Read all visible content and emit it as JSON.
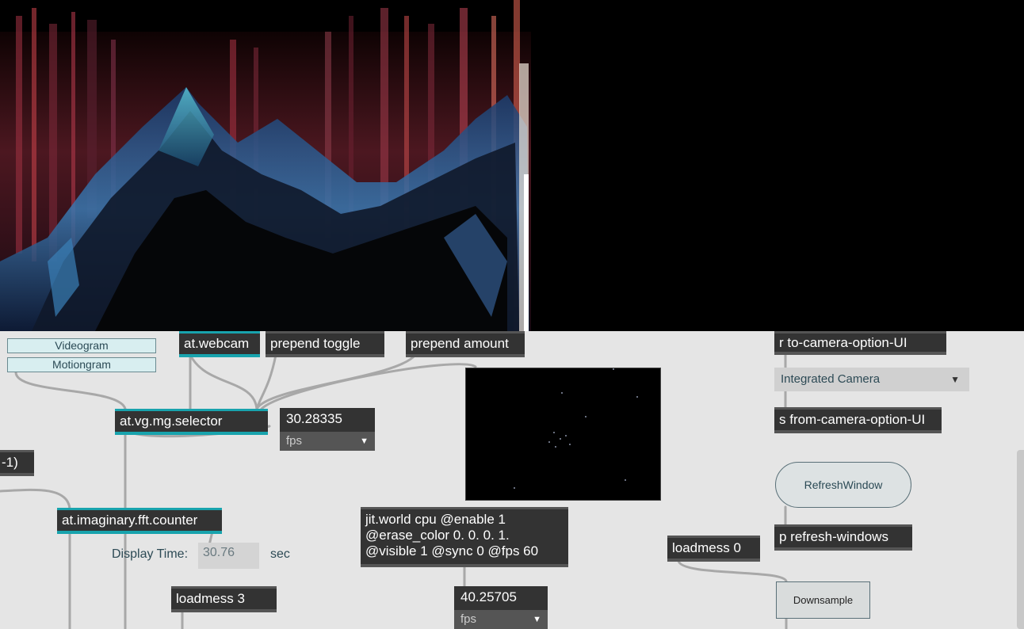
{
  "objects": {
    "at_webcam": "at.webcam",
    "prepend_toggle": "prepend toggle",
    "prepend_amount": "prepend amount",
    "selector": "at.vg.mg.selector",
    "fft_counter": "at.imaginary.fft.counter",
    "loadmess_3": "loadmess 3",
    "loadmess_0": "loadmess 0",
    "r_camera": "r to-camera-option-UI",
    "s_camera": "s from-camera-option-UI",
    "p_refresh": "p refresh-windows",
    "partial": "-1)",
    "jit_world": "jit.world cpu @enable 1\n@erase_color 0. 0. 0. 1.\n@visible 1 @sync 0 @fps 60"
  },
  "buttons": {
    "videogram": "Videogram",
    "motiongram": "Motiongram",
    "refresh_window": "RefreshWindow",
    "downsample": "Downsample"
  },
  "fps1": {
    "value": "30.28335",
    "unit": "fps"
  },
  "fps2": {
    "value": "40.25705",
    "unit": "fps"
  },
  "display_time": {
    "label": "Display Time:",
    "value": "30.76",
    "unit": "sec"
  },
  "camera_menu": {
    "selected": "Integrated Camera"
  },
  "colors": {
    "accent": "#18a3ad",
    "object_bg": "#333333",
    "canvas": "#e5e5e5"
  }
}
